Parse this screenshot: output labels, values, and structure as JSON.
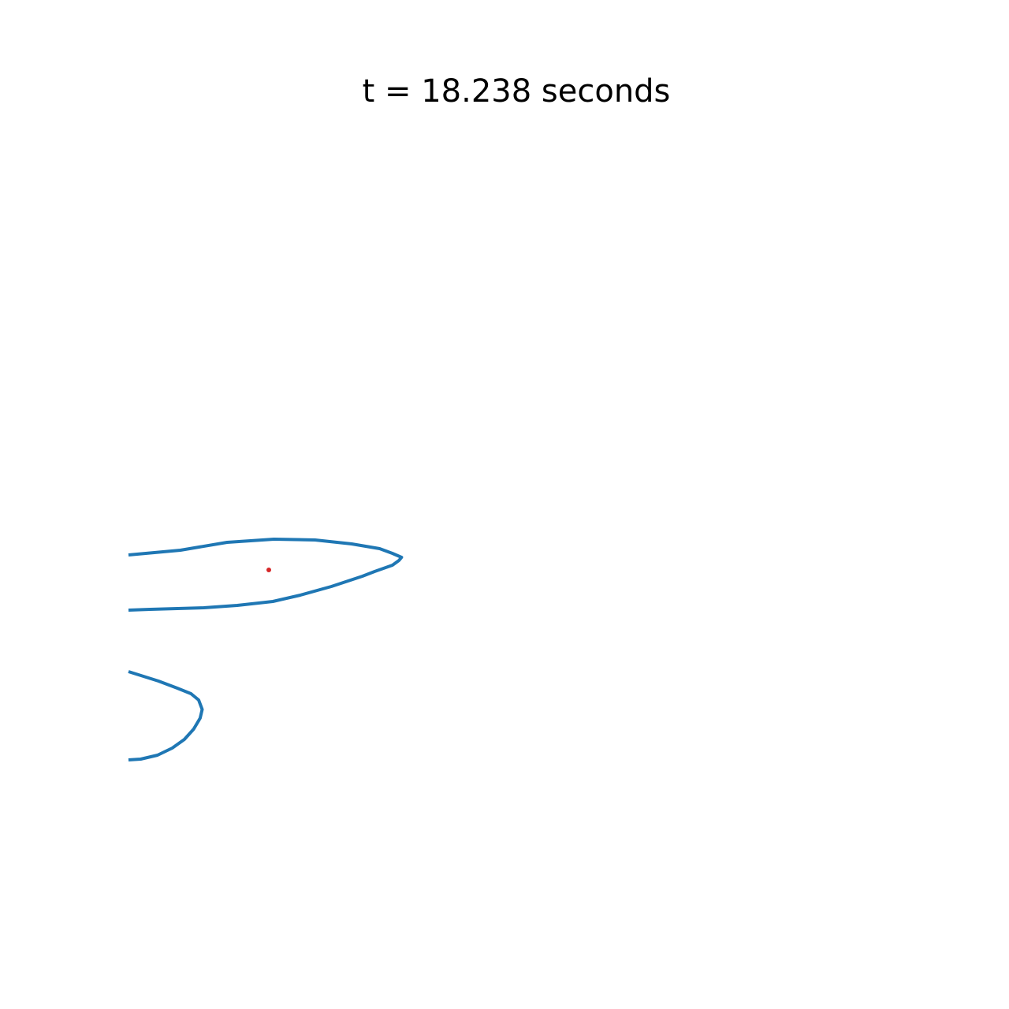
{
  "chart_data": {
    "type": "line",
    "title": "t = 18.238 seconds",
    "xlabel": "",
    "ylabel": "",
    "axes_visible": false,
    "grid": false,
    "xlim": [
      0,
      1
    ],
    "ylim": [
      0,
      1
    ],
    "series": [
      {
        "color": "#1f77b4",
        "points": [
          [
            0.0,
            0.474
          ],
          [
            0.102,
            0.468
          ],
          [
            0.194,
            0.458
          ],
          [
            0.286,
            0.454
          ],
          [
            0.367,
            0.455
          ],
          [
            0.439,
            0.46
          ],
          [
            0.494,
            0.466
          ],
          [
            0.519,
            0.472
          ],
          [
            0.537,
            0.477
          ],
          [
            0.532,
            0.481
          ],
          [
            0.519,
            0.487
          ],
          [
            0.484,
            0.495
          ],
          [
            0.46,
            0.501
          ],
          [
            0.399,
            0.514
          ],
          [
            0.338,
            0.525
          ],
          [
            0.284,
            0.533
          ],
          [
            0.214,
            0.538
          ],
          [
            0.148,
            0.541
          ],
          [
            0.043,
            0.543
          ],
          [
            0.0,
            0.544
          ]
        ]
      },
      {
        "color": "#1f77b4",
        "points": [
          [
            0.0,
            0.622
          ],
          [
            0.059,
            0.634
          ],
          [
            0.096,
            0.643
          ],
          [
            0.123,
            0.65
          ],
          [
            0.138,
            0.658
          ],
          [
            0.145,
            0.67
          ],
          [
            0.141,
            0.681
          ],
          [
            0.128,
            0.695
          ],
          [
            0.11,
            0.708
          ],
          [
            0.086,
            0.719
          ],
          [
            0.057,
            0.728
          ],
          [
            0.024,
            0.733
          ],
          [
            0.0,
            0.734
          ]
        ]
      }
    ],
    "markers": [
      {
        "color": "#d62728",
        "point": [
          0.276,
          0.493
        ]
      }
    ]
  }
}
